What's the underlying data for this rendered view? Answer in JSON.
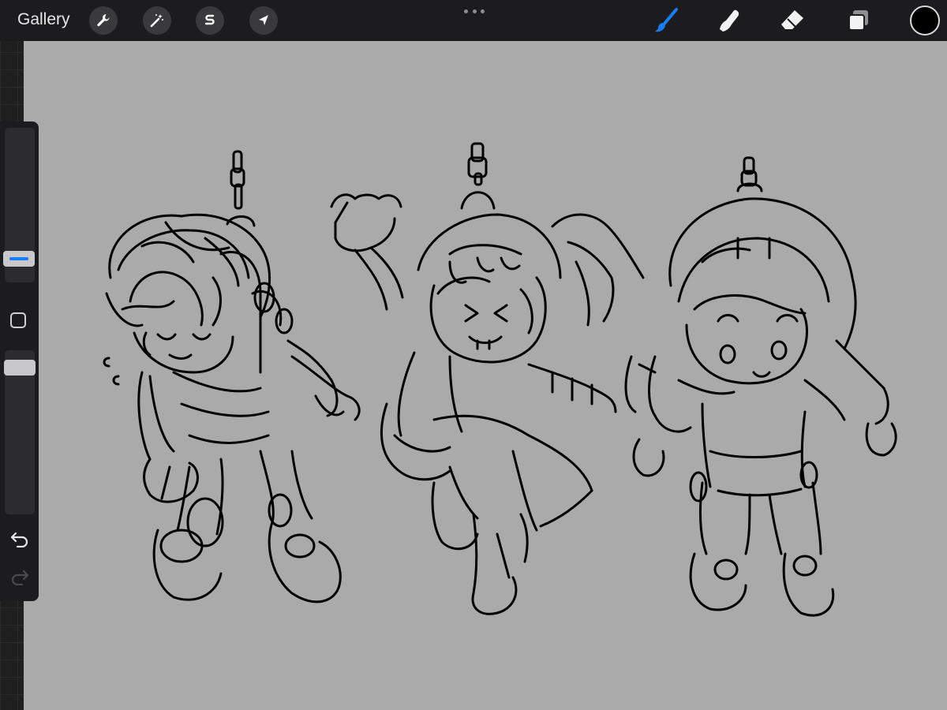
{
  "toolbar": {
    "gallery_label": "Gallery",
    "left_tools": [
      {
        "name": "actions",
        "icon": "wrench-icon"
      },
      {
        "name": "adjustments",
        "icon": "magic-wand-icon"
      },
      {
        "name": "selection",
        "icon": "selection-s-icon"
      },
      {
        "name": "transform",
        "icon": "arrow-cursor-icon"
      }
    ],
    "more_icon": "ellipsis-icon",
    "right_tools": [
      {
        "name": "brush",
        "icon": "brush-icon",
        "active": true
      },
      {
        "name": "smudge",
        "icon": "smudge-finger-icon",
        "active": false
      },
      {
        "name": "eraser",
        "icon": "eraser-icon",
        "active": false
      },
      {
        "name": "layers",
        "icon": "layers-icon",
        "active": false
      }
    ],
    "current_color": "#000000"
  },
  "colors": {
    "accent": "#1a7cf5",
    "toolbar_bg": "#1c1c1e",
    "canvas_bg": "#aaaaaa",
    "stroke": "#000000"
  },
  "sidebar": {
    "brush_size_icon": "size-slider-handle",
    "modify_icon": "square-modify-icon",
    "opacity_icon": "opacity-slider-handle",
    "undo_icon": "undo-arrow-icon",
    "redo_icon": "redo-arrow-icon",
    "redo_enabled": false
  },
  "canvas": {
    "content": "sketch-drawing"
  }
}
